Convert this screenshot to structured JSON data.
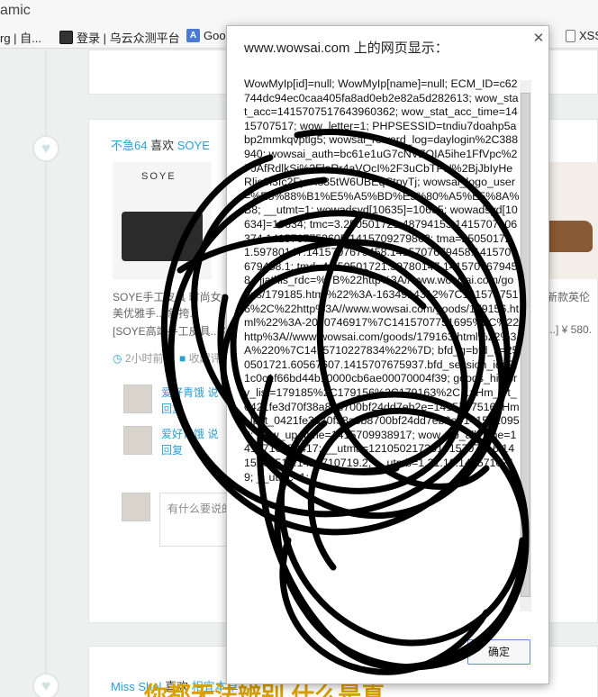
{
  "browser": {
    "title_fragment": "amic",
    "bookmarks": [
      {
        "label": "rg | 自..."
      },
      {
        "label": "登录 | 乌云众测平台",
        "icon": "bookmark-icon"
      },
      {
        "label": "Goo",
        "icon": "app-icon"
      },
      {
        "label": "XSS",
        "icon": "page-icon"
      }
    ]
  },
  "feed": {
    "post": {
      "user": "不急64",
      "action": "喜欢",
      "brand": "SOYE",
      "logo_text": "SOYE",
      "desc_line1": "SOYE手工皮具 时尚女士",
      "desc_line2": "美优雅手... 斜挎...",
      "desc_line3": "[SOYE高端手工皮具...¥",
      "right_line1": "新款英伦",
      "right_line2": "...] ¥ 580.",
      "time": "2小时前",
      "collect": "收起评"
    },
    "comments": [
      {
        "name": "爱好青饿 说",
        "reply": "回复"
      },
      {
        "name": "爱好青饿 说",
        "reply": "回复"
      }
    ],
    "comment_placeholder": "有什么要说的",
    "next_post": {
      "user": "Miss Shel",
      "action": "喜欢",
      "brand": "相宜本草"
    },
    "banner_text": "你都无法辨别 什么是真"
  },
  "dialog": {
    "title": "www.wowsai.com 上的网页显示：",
    "message": "WowMyIp[id]=null; WowMyIp[name]=null; ECM_ID=c62744dc94ec0caa405fa8ad0eb2e82a5d282613; wow_stat_acc=1415707517643960362; wow_stat_acc_time=1415707517; wow_letter=1; PHPSESSID=tndiu7doahp5abp2mmkqvptlg5; wowsai_reward_log=daylogin%2C388940; wowsai_auth=bc61e1uG7cNVZQIA5ihe1FfVpc%2FJAfRdlkSi%2FlaRr4aVOcI%2F3uCbTPN%2BjJbIyHeRlio9i3Ic2Fyo4s35tW6UBEqCtpyTj; wowsai_logo_user=%E5%88%B1%E5%A5%BD%E5%80%A5%E5%8A%B8; __utmt=1; wowadsyd[10635]=10635; wowadsyd[10634]=10634; tmc=3.250501721.48794153.1415707106374.1415707753605.1415709279862; tma=250501721.59780147.1415707679458.1415707679458.1415707679458.1; tmd=4.250501721.59780147.1415707679458.; jiathis_rdc=%7B%22http%3A//www.wowsai.com/goods/179185.html%22%3A-1634914312%7C1415707516%2C%22http%3A//www.wowsai.com/goods/179156.html%22%3A-2010746917%7C1415707751695%2C%22http%3A//www.wowsai.com/goods/179163.html%22%3A%220%7C1415710227834%22%7D; bfd_g=bfd_s=250501721.60567607.1415707675937.bfd_session_id=91c0c1f66bd44b10000cb6ae00070004f39; goods_history_list=179185%2C179156%2C179163%2C...; Hm_lvt_0421fe3d70f38a8b8700bf24dd7eb2e=1415707516; Hm_lpvt_0421fe3d70f38a8b8700bf24dd7eb2e=1415710958; wow_up_time=1415709938917; wow_up_all_time=1415710959417; __utma=121050217331415707516.1415707516.1415710719.2; __utmb=1.31.10.1415710719; __utmc=1;",
    "ok_label": "确定"
  }
}
